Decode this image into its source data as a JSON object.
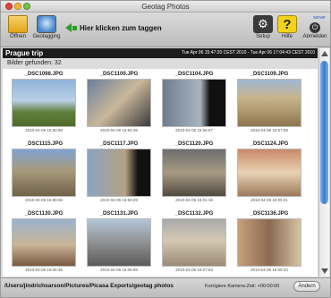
{
  "window": {
    "title": "Geotag Photos"
  },
  "toolbar": {
    "open_label": "Öffnen",
    "geotagging_label": "Geotagging",
    "hint": "Hier klicken zum taggen",
    "setup_label": "Setup",
    "help_label": "Hilfe",
    "logout_label": "Abmelden",
    "server_label": "server"
  },
  "trip": {
    "name": "Prague trip",
    "range": "Tue Apr 06 15:47:20 CEST 2010 - Tue Apr 06 17:04:43 CEST 2010",
    "found": "Bilder gefunden: 32"
  },
  "photos": [
    {
      "name": "_DSC1098.JPG",
      "date": "2010-04-06 15:50:08"
    },
    {
      "name": "_DSC1100.JPG",
      "date": "2010-04-06 15:50:46"
    },
    {
      "name": "_DSC1104.JPG",
      "date": "2010-04-06 15:56:07"
    },
    {
      "name": "_DSC1109.JPG",
      "date": "2010-04-06 15:57:58"
    },
    {
      "name": "_DSC1115.JPG",
      "date": "2010-04-06 15:59:06"
    },
    {
      "name": "_DSC1117.JPG",
      "date": "2010-04-06 15:59:29"
    },
    {
      "name": "_DSC1120.JPG",
      "date": "2010-04-06 16:01:18"
    },
    {
      "name": "_DSC1124.JPG",
      "date": "2010-04-06 16:05:21"
    },
    {
      "name": "_DSC1130.JPG",
      "date": "2010-04-06 16:06:45"
    },
    {
      "name": "_DSC1131.JPG",
      "date": "2010-04-06 16:06:59"
    },
    {
      "name": "_DSC1132.JPG",
      "date": "2010-04-06 16:07:53"
    },
    {
      "name": "_DSC1136.JPG",
      "date": "2010-04-06 16:08:34"
    }
  ],
  "status": {
    "path": "/Users/jindrichsarson/Pictures/Picasa Exports/geotag photos",
    "correction": "Korrigiere Kamera-Zeit: +00:00:00",
    "change_label": "Ändern"
  },
  "colors": {
    "accent": "#3a7bd2",
    "hint_arrow": "#2e9a2a",
    "header_bg": "#1c1c1c"
  }
}
